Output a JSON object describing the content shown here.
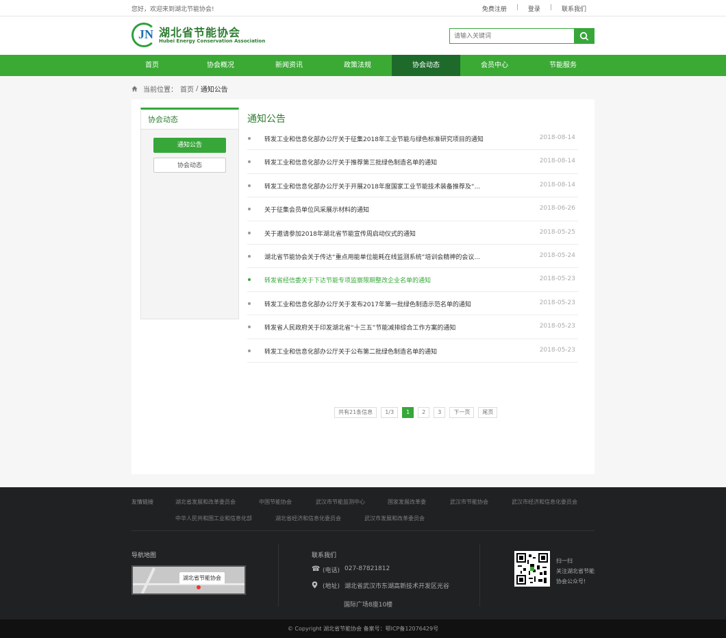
{
  "topbar": {
    "greeting": "您好，欢迎来到湖北节能协会!",
    "links": [
      "免费注册",
      "登录",
      "联系我们"
    ],
    "separator": "|"
  },
  "header": {
    "logo_letters": "JN",
    "logo_cn": "湖北省节能协会",
    "logo_en": "Hubei Energy Conservation Association",
    "search_placeholder": "请输入关键词"
  },
  "nav": {
    "items": [
      "首页",
      "协会概况",
      "新闻资讯",
      "政策法规",
      "协会动态",
      "会员中心",
      "节能服务"
    ],
    "active": "协会动态"
  },
  "breadcrumb": {
    "prefix": "当前位置：",
    "home": "首页",
    "sep": " / ",
    "current": "通知公告"
  },
  "sidebar": {
    "title": "协会动态",
    "items": [
      {
        "label": "通知公告",
        "active": true
      },
      {
        "label": "协会动态",
        "active": false
      }
    ]
  },
  "list": {
    "title": "通知公告",
    "items": [
      {
        "title": "转发工业和信息化部办公厅关于征集2018年工业节能与绿色标准研究项目的通知",
        "date": "2018-08-14"
      },
      {
        "title": "转发工业和信息化部办公厅关于推荐第三批绿色制造名单的通知",
        "date": "2018-08-14"
      },
      {
        "title": "转发工业和信息化部办公厅关于开展2018年度国家工业节能技术装备推荐及“...",
        "date": "2018-08-14"
      },
      {
        "title": "关于征集会员单位风采展示材料的通知",
        "date": "2018-06-26"
      },
      {
        "title": "关于邀请参加2018年湖北省节能宣传周启动仪式的通知",
        "date": "2018-05-25"
      },
      {
        "title": "湖北省节能协会关于传达“重点用能单位能耗在线监测系统”培训会精神的会议...",
        "date": "2018-05-24"
      },
      {
        "title": "转发省经信委关于下达节能专项监察限期整改企业名单的通知",
        "date": "2018-05-23"
      },
      {
        "title": "转发工业和信息化部办公厅关于发布2017年第一批绿色制造示范名单的通知",
        "date": "2018-05-23"
      },
      {
        "title": "转发省人民政府关于印发湖北省“十三五”节能减排综合工作方案的通知",
        "date": "2018-05-23"
      },
      {
        "title": "转发工业和信息化部办公厅关于公布第二批绿色制造名单的通知",
        "date": "2018-05-23"
      }
    ],
    "highlighted_index": 6
  },
  "pager": {
    "total": "共有21条信息",
    "page_of": "1/3",
    "pages": [
      "1",
      "2",
      "3"
    ],
    "current": "1",
    "next": "下一页",
    "last": "尾页"
  },
  "footer": {
    "links_label": "友情链接",
    "links_row1": [
      "湖北省发展和改革委员会",
      "中国节能协会",
      "武汉市节能监测中心",
      "国家发展改革委",
      "武汉市节能协会",
      "武汉市经济和信息化委员会"
    ],
    "links_row2": [
      "中华人民共和国工业和信息化部",
      "湖北省经济和信息化委员会",
      "武汉市发展和改革委员会"
    ],
    "map_title": "导航地图",
    "map_label": "湖北省节能协会",
    "contact_title": "联系我们",
    "phone_label": "(电话)",
    "phone": "027-87821812",
    "addr_label": "(地址)",
    "addr1": "湖北省武汉市东湖高新技术开发区光谷",
    "addr2": "国际广场8座10楼",
    "qr_text": [
      "扫一扫",
      "关注湖北省节能",
      "协会公众号!"
    ],
    "copyright": "© Copyright 湖北省节能协会 备案号：鄂ICP备12076429号"
  }
}
